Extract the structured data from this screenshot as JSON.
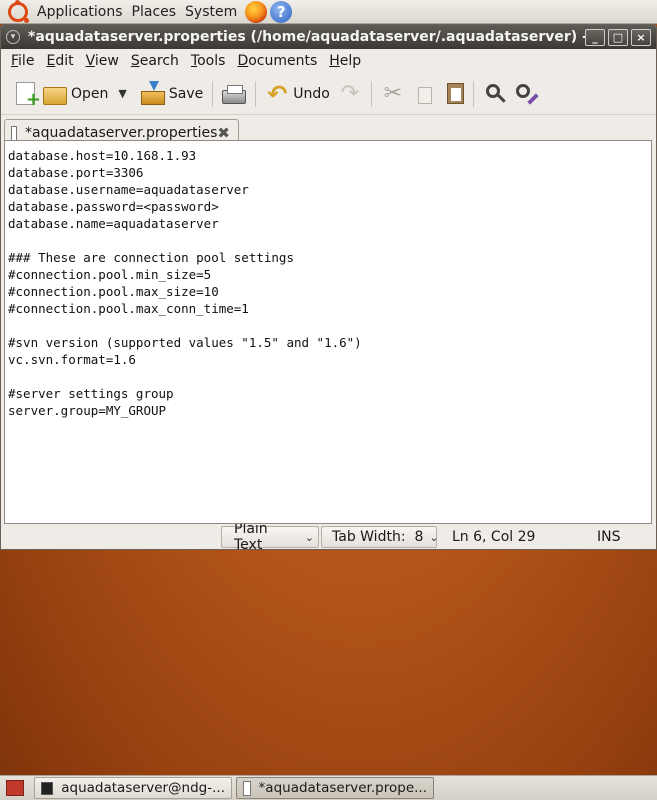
{
  "top_panel": {
    "menus": [
      "Applications",
      "Places",
      "System"
    ],
    "icons": [
      "ubuntu-logo",
      "firefox-icon",
      "help-icon"
    ],
    "help_glyph": "?"
  },
  "window": {
    "title": "*aquadataserver.properties (/home/aquadataserver/.aquadataserver) - gedit",
    "title_buttons": [
      "_",
      "□",
      "×"
    ]
  },
  "menubar": [
    {
      "label": "File",
      "mnemonic": "F"
    },
    {
      "label": "Edit",
      "mnemonic": "E"
    },
    {
      "label": "View",
      "mnemonic": "V"
    },
    {
      "label": "Search",
      "mnemonic": "S"
    },
    {
      "label": "Tools",
      "mnemonic": "T"
    },
    {
      "label": "Documents",
      "mnemonic": "D"
    },
    {
      "label": "Help",
      "mnemonic": "H"
    }
  ],
  "toolbar": {
    "open_label": "Open",
    "save_label": "Save",
    "undo_label": "Undo"
  },
  "tab": {
    "label": "*aquadataserver.properties"
  },
  "editor": {
    "lines": [
      "database.host=10.168.1.93",
      "database.port=3306",
      "database.username=aquadataserver",
      "database.password=<password>",
      "database.name=aquadataserver",
      "",
      "### These are connection pool settings",
      "#connection.pool.min_size=5",
      "#connection.pool.max_size=10",
      "#connection.pool.max_conn_time=1",
      "",
      "#svn version (supported values \"1.5\" and \"1.6\")",
      "vc.svn.format=1.6",
      "",
      "#server settings group",
      "server.group=MY_GROUP"
    ]
  },
  "statusbar": {
    "language": "Plain Text",
    "tab_width": "Tab Width:  8",
    "position": "Ln 6, Col 29",
    "mode": "INS"
  },
  "taskbar": {
    "tasks": [
      {
        "label": "aquadataserver@ndg-..."
      },
      {
        "label": "*aquadataserver.prope..."
      }
    ]
  }
}
